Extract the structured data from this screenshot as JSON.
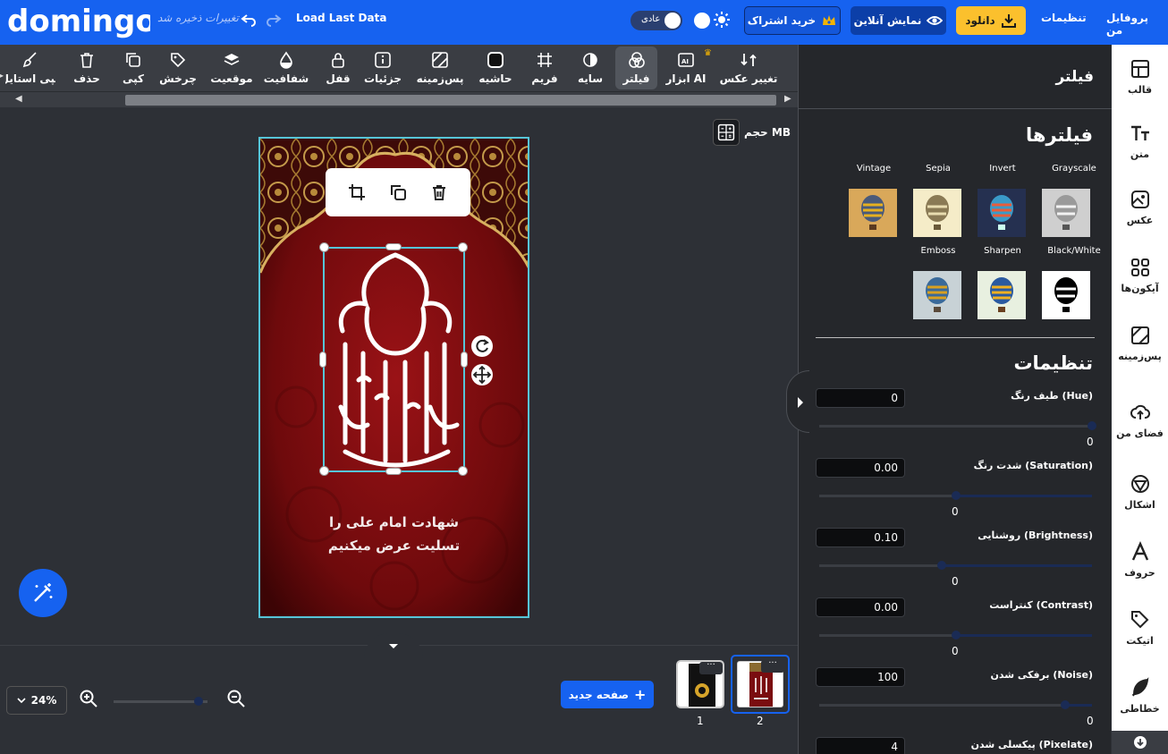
{
  "header": {
    "logo": "domingo",
    "save_state": "تغییرات ذخیره شد",
    "load_last": "Load Last Data",
    "theme_label": "عادی",
    "subscribe": "خرید اشتراک",
    "preview": "نمایش آنلاین",
    "download": "دانلود",
    "settings": "تنظیمات",
    "profile": "پروفایل من"
  },
  "toolbar": {
    "change_photo": "تغییر عکس",
    "ai_tools": "ابزار AI",
    "filter": "فیلتر",
    "shadow": "سایه",
    "frame": "فریم",
    "border": "حاشیه",
    "background": "پس‌زمینه",
    "details": "جزئیات",
    "lock": "قفل",
    "transparency": "شفافیت",
    "position": "موقعیت",
    "rotate": "چرخش",
    "copy": "کپی",
    "delete": "حذف",
    "copy_style": "کپی استایل"
  },
  "canvas": {
    "size_label": "حجم MB",
    "poster_line1": "شهادت امام علی را",
    "poster_line2": "تسلیت عرض میکنیم"
  },
  "footer": {
    "zoom": "24%",
    "zoom_level": 0.9,
    "new_page": "صفحه جدید",
    "pages": [
      "1",
      "2"
    ],
    "page_menu": "···"
  },
  "panel": {
    "title": "فیلتر",
    "filters_title": "فیلترها",
    "filters": [
      "Grayscale",
      "Invert",
      "Sepia",
      "Vintage",
      "Black/White",
      "Sharpen",
      "Emboss"
    ],
    "settings_title": "تنظیمات",
    "settings": [
      {
        "label": "طیف رنگ (Hue)",
        "value": "0",
        "below": "0",
        "fraction": 1.0
      },
      {
        "label": "شدت رنگ (Saturation)",
        "value": "0.00",
        "below": "0",
        "fraction": 0.5
      },
      {
        "label": "روشنایی (Brightness)",
        "value": "0.10",
        "below": "0",
        "fraction": 0.45
      },
      {
        "label": "کنتراست (Contrast)",
        "value": "0.00",
        "below": "0",
        "fraction": 0.5
      },
      {
        "label": "برفکی شدن (Noise)",
        "value": "100",
        "below": "0",
        "fraction": 0.9
      },
      {
        "label": "پیکسلی شدن (Pixelate)",
        "value": "4",
        "below": "",
        "fraction": 0.0
      }
    ]
  },
  "sidebar": {
    "items": [
      "قالب",
      "متن",
      "عکس",
      "آیکون‌ها",
      "پس‌زمینه",
      "فضای من",
      "اشکال",
      "حروف",
      "اتیکت",
      "خطاطی"
    ]
  },
  "colors": {
    "brand": "#1662f0",
    "download": "#fbc02d",
    "selection": "#56c5d8",
    "poster_red": "#8a0f12"
  }
}
